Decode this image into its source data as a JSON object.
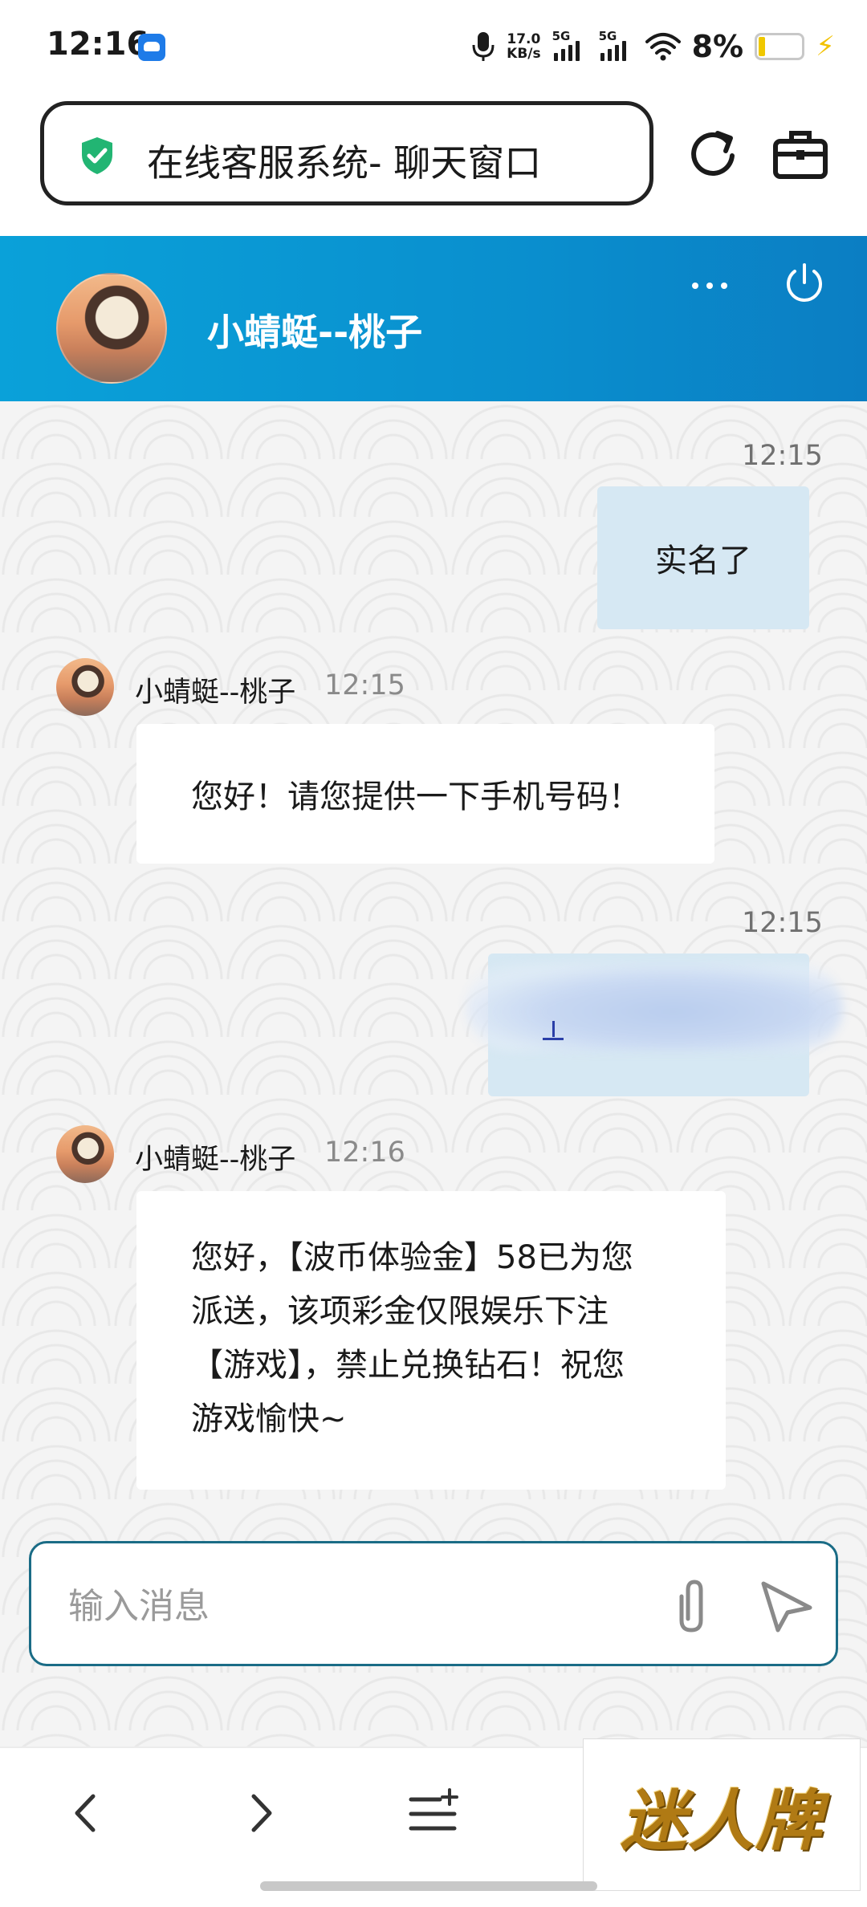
{
  "status_bar": {
    "time": "12:16",
    "network_speed_value": "17.0",
    "network_speed_unit": "KB/s",
    "signal_1_label": "5G",
    "signal_2_label": "5G",
    "battery_percent": "8%",
    "icons": [
      "app-notification-icon",
      "microphone-icon",
      "signal-icon",
      "wifi-icon",
      "battery-icon",
      "charging-bolt-icon"
    ]
  },
  "browser": {
    "url_title": "在线客服系统- 聊天窗口",
    "icons": [
      "shield-check-icon",
      "refresh-icon",
      "toolbox-icon"
    ]
  },
  "chat_header": {
    "agent_name": "小蜻蜓--桃子",
    "icons": [
      "more-icon",
      "power-icon"
    ]
  },
  "messages": [
    {
      "direction": "outgoing",
      "time": "12:15",
      "text": "实名了"
    },
    {
      "direction": "incoming",
      "sender": "小蜻蜓--桃子",
      "time": "12:15",
      "text": "您好！请您提供一下手机号码！"
    },
    {
      "direction": "outgoing",
      "time": "12:15",
      "text": ""
    },
    {
      "direction": "incoming",
      "sender": "小蜻蜓--桃子",
      "time": "12:16",
      "lines": [
        "您好，【波币体验金】58已为您",
        "派送，该项彩金仅限娱乐下注",
        "【游戏】，禁止兑换钻石！祝您",
        "游戏愉快~"
      ]
    }
  ],
  "composer": {
    "placeholder": "输入消息",
    "value": "",
    "icons": [
      "paperclip-icon",
      "send-icon"
    ]
  },
  "bottom_nav": {
    "icons": [
      "back-icon",
      "forward-icon",
      "menu-icon"
    ],
    "logo_text": "迷人牌"
  },
  "colors": {
    "header_blue": "#0a8fce",
    "outgoing_bubble": "#d6e8f3",
    "incoming_bubble": "#ffffff",
    "input_border": "#1a6c86",
    "shield_green": "#22b573",
    "logo_gold": "#b07a14"
  }
}
